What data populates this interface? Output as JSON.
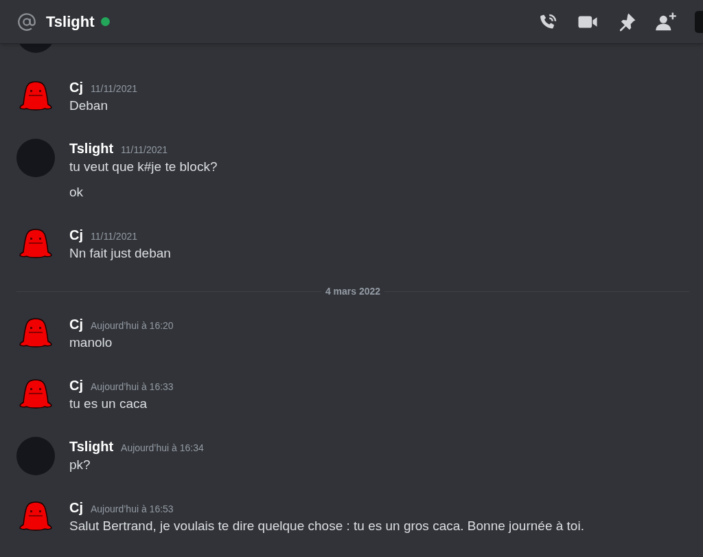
{
  "header": {
    "title": "Tslight",
    "online": true
  },
  "feed": [
    {
      "kind": "message",
      "author": "Cj",
      "avatar": {
        "kind": "blob"
      },
      "time": "11/11/2021",
      "lines": [
        "Deban"
      ]
    },
    {
      "kind": "message",
      "author": "Tslight",
      "avatar": {
        "kind": "dark"
      },
      "time": "11/11/2021",
      "lines": [
        "tu veut que k#je te block?",
        "ok"
      ]
    },
    {
      "kind": "message",
      "author": "Cj",
      "avatar": {
        "kind": "blob"
      },
      "time": "11/11/2021",
      "lines": [
        "Nn fait just deban"
      ]
    },
    {
      "kind": "divider",
      "label": "4 mars 2022"
    },
    {
      "kind": "message",
      "author": "Cj",
      "avatar": {
        "kind": "blob"
      },
      "time": "Aujourd’hui à 16:20",
      "lines": [
        "manolo"
      ]
    },
    {
      "kind": "message",
      "author": "Cj",
      "avatar": {
        "kind": "blob"
      },
      "time": "Aujourd’hui à 16:33",
      "lines": [
        "tu es un caca"
      ]
    },
    {
      "kind": "message",
      "author": "Tslight",
      "avatar": {
        "kind": "dark"
      },
      "time": "Aujourd’hui à 16:34",
      "lines": [
        "pk?"
      ]
    },
    {
      "kind": "message",
      "author": "Cj",
      "avatar": {
        "kind": "blob"
      },
      "time": "Aujourd’hui à 16:53",
      "lines": [
        "Salut Bertrand, je voulais te dire quelque chose : tu es un gros caca. Bonne journée à toi."
      ]
    }
  ]
}
